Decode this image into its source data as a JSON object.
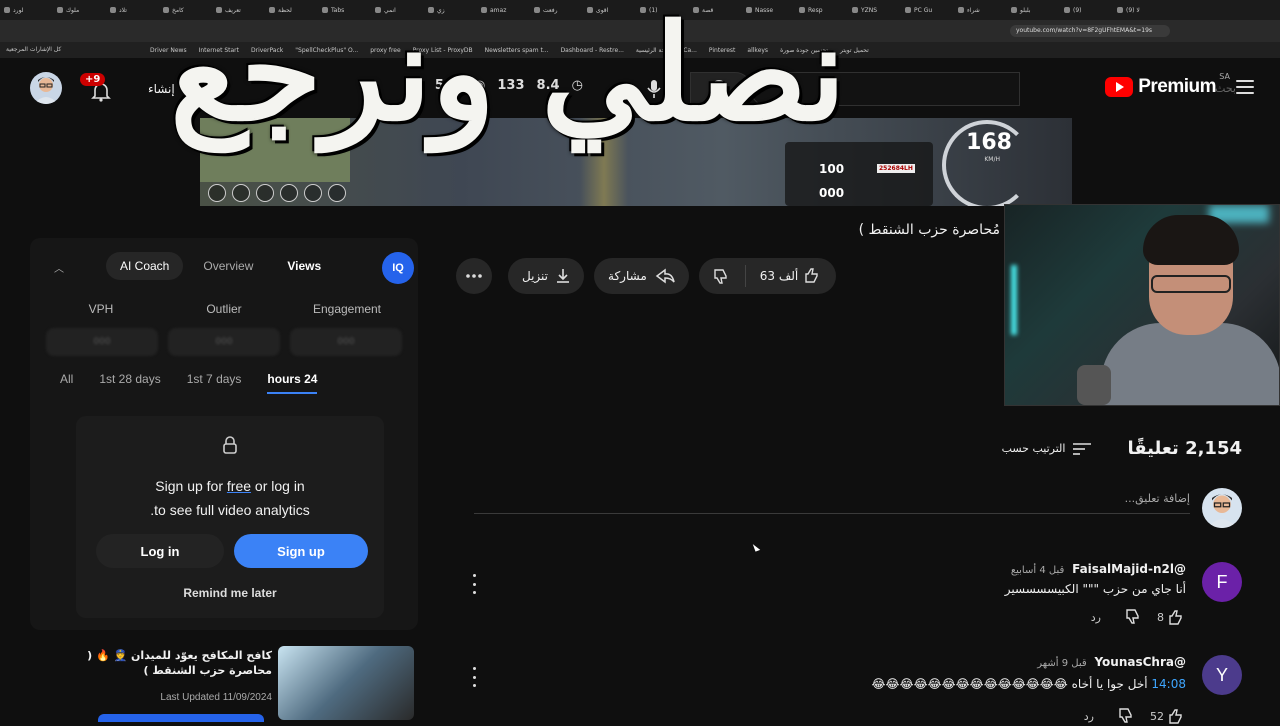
{
  "browser": {
    "tabs": [
      "لورد",
      "ملوك",
      "تلاد",
      "كامخ",
      "تعريف",
      "لحظة",
      "Tabs",
      "انمي",
      "زي",
      "amaz",
      "رفعت",
      "اقوى",
      "(1)",
      "قصة",
      "Nasse",
      "Resp",
      "YZNS",
      "PC Gu",
      "شراء",
      "بلبلو",
      "(9)",
      "(9) لا"
    ],
    "url": "youtube.com/watch?v=8F2gUFhtEMA&t=19s",
    "bookmarks": [
      "Driver News",
      "Internet Start",
      "DriverPack",
      "\"SpellCheckPlus\" O...",
      "proxy free",
      "Proxy List - ProxyDB",
      "Newsletters spam t...",
      "Dashboard - Restre...",
      "الصفحة الرئيسية - Ca...",
      "Pinterest",
      "allkeys",
      "تحسين جودة صورة",
      "تحميل تويتر"
    ],
    "bookmarks_right": "كل الإشارات المرجعية"
  },
  "header": {
    "logo_text": "Premium",
    "country": "SA",
    "search_placeholder": "بحث",
    "stat_1": "501",
    "stat_2": "133",
    "stat_3": "8.4",
    "create_label": "إنشاء",
    "notif_badge": "+9"
  },
  "overlay": {
    "text": "نصلي ونرجع"
  },
  "video": {
    "speed": "168",
    "speed_unit": "KM/H",
    "dash_val_1": "100",
    "dash_val_2": "000",
    "plate": "252684LH"
  },
  "title": "مُحاصرة حزب الشنقط )",
  "actions": {
    "like_count": "63 ألف",
    "share_label": "مشاركة",
    "download_label": "تنزيل"
  },
  "panel": {
    "tabs": [
      "AI Coach",
      "Overview",
      "Views"
    ],
    "logo": "IQ",
    "metrics": [
      "VPH",
      "Outlier",
      "Engagement"
    ],
    "metric_placeholder": "000",
    "ranges": [
      "All",
      "1st 28 days",
      "1st 7 days",
      "hours 24"
    ],
    "lock_line_1_pre": "Sign up for",
    "lock_line_1_link": "free",
    "lock_line_1_post": "or log in",
    "lock_line_2": ".to see full video analytics",
    "login_label": "Log in",
    "signup_label": "Sign up",
    "remind_label": "Remind me later"
  },
  "recommended": {
    "title_line_1": "كافح المكافح يعوّد للميدان 👮 🔥 (",
    "title_line_2": "محاصرة حزب الشنقط )",
    "meta": "Last Updated 11/09/2024"
  },
  "comments": {
    "count": "2,154 تعليقًا",
    "sort_label": "الترتيب حسب",
    "add_placeholder": "إضافة تعليق...",
    "reply_label": "رد",
    "items": [
      {
        "initial": "F",
        "color": "#6b21a8",
        "name": "@FaisalMajid-n2l",
        "when": "قبل 4 أسابيع",
        "body": "أنا جاي من حزب \"\"\" الكبيسسسسير",
        "likes": "8"
      },
      {
        "initial": "Y",
        "color": "#4c3b8c",
        "name": "@YounasChra",
        "when": "قبل 9 أشهر",
        "timestamp": "14:08",
        "body": "أخل جوا يا أخاه 😂😂😂😂😂😂😂😂😂😂😂😂😂😂",
        "likes": "52"
      }
    ]
  }
}
